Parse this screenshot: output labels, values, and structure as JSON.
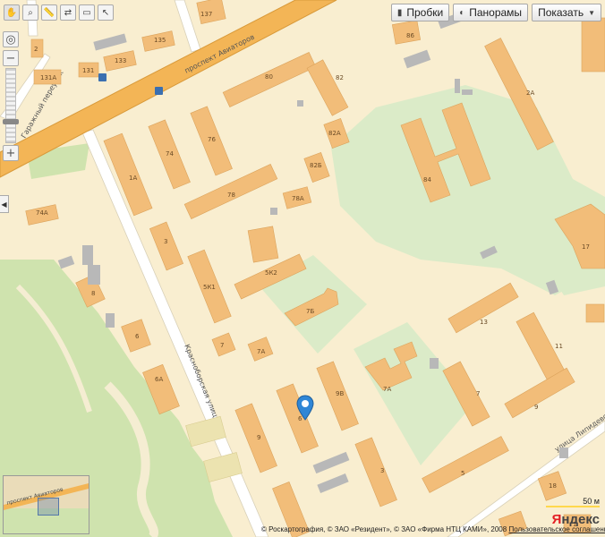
{
  "toolbar": {
    "tools": [
      {
        "name": "hand-tool",
        "icon": "hand-icon",
        "glyph": "✋"
      },
      {
        "name": "zoom-tool",
        "icon": "magnifier-icon",
        "glyph": "⌕"
      },
      {
        "name": "ruler-tool",
        "icon": "ruler-icon",
        "glyph": "📏"
      },
      {
        "name": "route-tool",
        "icon": "route-icon",
        "glyph": "⇄"
      },
      {
        "name": "print-tool",
        "icon": "printer-icon",
        "glyph": "▭"
      },
      {
        "name": "cursor-tool",
        "icon": "cursor-icon",
        "glyph": "↖"
      }
    ],
    "traffic_label": "Пробки",
    "panoramas_label": "Панорамы",
    "show_label": "Показать"
  },
  "streets": {
    "aviators_avenue": "проспект Авиаторов",
    "aviators_avenue_minimap": "проспект Авиаторов",
    "krasnoborskaya": "Красноборская улица",
    "lipidevskogo": "улица Липидевского",
    "lane": "Гаражный переулок"
  },
  "houses": [
    "137",
    "135",
    "86",
    "2",
    "133",
    "131",
    "131А",
    "80",
    "82",
    "2А",
    "76",
    "74",
    "82А",
    "82Б",
    "84",
    "1А",
    "78",
    "78А",
    "74А",
    "3",
    "17",
    "5К2",
    "8",
    "5К1",
    "7Б",
    "13",
    "6",
    "7",
    "7А",
    "11",
    "6А",
    "9В",
    "7А",
    "7",
    "9",
    "9",
    "6",
    "3",
    "5",
    "18",
    "1"
  ],
  "scale": {
    "label": "50 м"
  },
  "logo": {
    "y": "Я",
    "rest": "ндекс"
  },
  "copyright": {
    "text": "© Роскартография, © ЗАО «Резидент», © ЗАО «Фирма НТЦ КАМИ», 2008",
    "link": "Пользовательское соглашение"
  },
  "colors": {
    "building": "#f2bd79",
    "park": "#dbebc8",
    "avenue": "#f3b556",
    "background": "#f9eed0"
  }
}
